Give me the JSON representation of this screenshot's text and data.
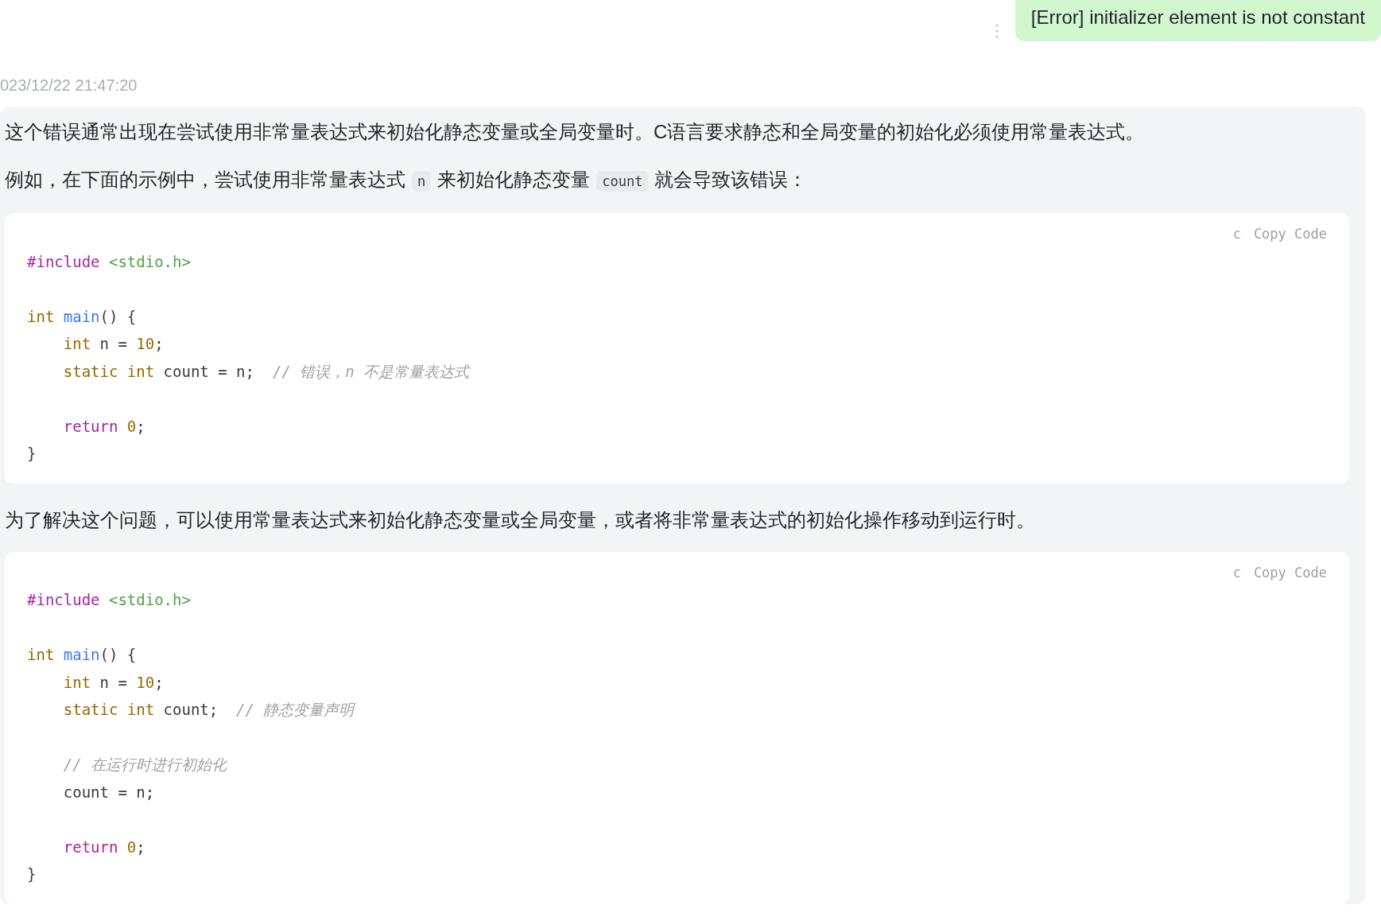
{
  "user_message": {
    "text": "[Error] initializer element is not constant"
  },
  "timestamp": "023/12/22 21:47:20",
  "answer": [
    {
      "kind": "paragraph",
      "parts": [
        {
          "kind": "text",
          "text": "这个错误通常出现在尝试使用非常量表达式来初始化静态变量或全局变量时。C语言要求静态和全局变量的初始化必须使用常量表达式。"
        }
      ]
    },
    {
      "kind": "paragraph",
      "parts": [
        {
          "kind": "text",
          "text": "例如，在下面的示例中，尝试使用非常量表达式"
        },
        {
          "kind": "code",
          "text": "n"
        },
        {
          "kind": "text",
          "text": "来初始化静态变量"
        },
        {
          "kind": "code",
          "text": "count"
        },
        {
          "kind": "text",
          "text": "就会导致该错误："
        }
      ]
    },
    {
      "kind": "codeblock",
      "language": "c",
      "copy_label": "Copy Code",
      "lines": [
        {
          "kind": "code",
          "tokens": [
            {
              "kind": "directive",
              "text": "#include"
            },
            {
              "kind": "string",
              "text": "<stdio.h>",
              "space_before": true
            }
          ]
        },
        {
          "kind": "blank"
        },
        {
          "kind": "code",
          "tokens": [
            {
              "kind": "keyword",
              "text": "int"
            },
            {
              "kind": "function",
              "text": "main",
              "space_before": true
            },
            {
              "kind": "plain",
              "text": "() {"
            }
          ]
        },
        {
          "kind": "code",
          "tokens": [
            {
              "kind": "keyword",
              "text": "    int"
            },
            {
              "kind": "plain",
              "text": " n = "
            },
            {
              "kind": "number",
              "text": "10"
            },
            {
              "kind": "plain",
              "text": ";"
            }
          ]
        },
        {
          "kind": "code",
          "tokens": [
            {
              "kind": "keyword",
              "text": "    static int"
            },
            {
              "kind": "plain",
              "text": " count = n;  "
            },
            {
              "kind": "comment",
              "text": "// 错误，n 不是常量表达式"
            }
          ]
        },
        {
          "kind": "blank"
        },
        {
          "kind": "code",
          "tokens": [
            {
              "kind": "control",
              "text": "    return"
            },
            {
              "kind": "number",
              "text": "0",
              "space_before": true
            },
            {
              "kind": "plain",
              "text": ";"
            }
          ]
        },
        {
          "kind": "code",
          "tokens": [
            {
              "kind": "plain",
              "text": "}"
            }
          ]
        }
      ]
    },
    {
      "kind": "paragraph",
      "parts": [
        {
          "kind": "text",
          "text": "为了解决这个问题，可以使用常量表达式来初始化静态变量或全局变量，或者将非常量表达式的初始化操作移动到运行时。"
        }
      ]
    },
    {
      "kind": "codeblock",
      "language": "c",
      "copy_label": "Copy Code",
      "lines": [
        {
          "kind": "code",
          "tokens": [
            {
              "kind": "directive",
              "text": "#include"
            },
            {
              "kind": "string",
              "text": "<stdio.h>",
              "space_before": true
            }
          ]
        },
        {
          "kind": "blank"
        },
        {
          "kind": "code",
          "tokens": [
            {
              "kind": "keyword",
              "text": "int"
            },
            {
              "kind": "function",
              "text": "main",
              "space_before": true
            },
            {
              "kind": "plain",
              "text": "() {"
            }
          ]
        },
        {
          "kind": "code",
          "tokens": [
            {
              "kind": "keyword",
              "text": "    int"
            },
            {
              "kind": "plain",
              "text": " n = "
            },
            {
              "kind": "number",
              "text": "10"
            },
            {
              "kind": "plain",
              "text": ";"
            }
          ]
        },
        {
          "kind": "code",
          "tokens": [
            {
              "kind": "keyword",
              "text": "    static int"
            },
            {
              "kind": "plain",
              "text": " count;  "
            },
            {
              "kind": "comment",
              "text": "// 静态变量声明"
            }
          ]
        },
        {
          "kind": "blank"
        },
        {
          "kind": "code",
          "tokens": [
            {
              "kind": "comment",
              "text": "    // 在运行时进行初始化"
            }
          ]
        },
        {
          "kind": "code",
          "tokens": [
            {
              "kind": "plain",
              "text": "    count = n;"
            }
          ]
        },
        {
          "kind": "blank"
        },
        {
          "kind": "code",
          "tokens": [
            {
              "kind": "control",
              "text": "    return"
            },
            {
              "kind": "number",
              "text": "0",
              "space_before": true
            },
            {
              "kind": "plain",
              "text": ";"
            }
          ]
        },
        {
          "kind": "code",
          "tokens": [
            {
              "kind": "plain",
              "text": "}"
            }
          ]
        }
      ]
    }
  ]
}
